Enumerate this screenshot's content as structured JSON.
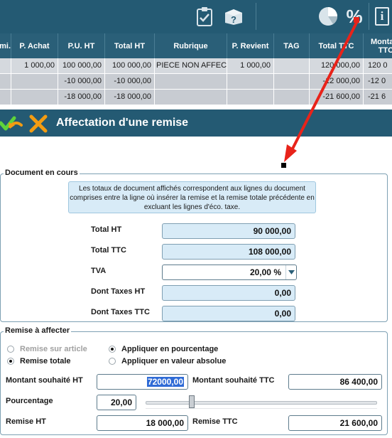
{
  "toolbar": {
    "icons": [
      "clipboard-check-icon",
      "box-question-icon",
      "pie-chart-icon",
      "percent-icon",
      "info-icon"
    ],
    "percent_label": "%",
    "info_label": "i"
  },
  "grid": {
    "columns": [
      "...mi.",
      "P. Achat",
      "P.U. HT",
      "Total HT",
      "Rubrique",
      "P. Revient",
      "TAG",
      "Total TTC",
      "Montant TTC"
    ],
    "rows": [
      [
        "",
        "1 000,00",
        "100 000,00",
        "100 000,00",
        "PIECE NON AFFECTEE",
        "1 000,00",
        "",
        "120 000,00",
        "120 0"
      ],
      [
        "",
        "",
        "-10 000,00",
        "-10 000,00",
        "",
        "",
        "",
        "-12 000,00",
        "-12 0"
      ],
      [
        "",
        "",
        "-18 000,00",
        "-18 000,00",
        "",
        "",
        "",
        "-21 600,00",
        "-21 6"
      ]
    ]
  },
  "dialog": {
    "title": "Affectation d'une remise",
    "document_group": {
      "legend": "Document en cours",
      "info": "Les totaux de document affichés correspondent aux lignes du document comprises entre la ligne où insérer la remise et la remise totale précédente en excluant les lignes d'éco. taxe.",
      "total_ht_label": "Total HT",
      "total_ht": "90 000,00",
      "total_ttc_label": "Total TTC",
      "total_ttc": "108 000,00",
      "tva_label": "TVA",
      "tva": "20,00 %",
      "taxes_ht_label": "Dont Taxes HT",
      "taxes_ht": "0,00",
      "taxes_ttc_label": "Dont Taxes TTC",
      "taxes_ttc": "0,00"
    },
    "remise_group": {
      "legend": "Remise à affecter",
      "radio_article": "Remise sur article",
      "radio_totale": "Remise totale",
      "radio_pourcentage": "Appliquer en pourcentage",
      "radio_absolue": "Appliquer en valeur absolue",
      "montant_ht_label": "Montant souhaité HT",
      "montant_ht": "72000,00",
      "montant_ttc_label": "Montant souhaité TTC",
      "montant_ttc": "86 400,00",
      "pourcentage_label": "Pourcentage",
      "pourcentage": "20,00",
      "slider_level_percent": 20,
      "remise_ht_label": "Remise HT",
      "remise_ht": "18 000,00",
      "remise_ttc_label": "Remise TTC",
      "remise_ttc": "21 600,00"
    }
  },
  "colors": {
    "toolbar": "#245a73",
    "header": "#2a5f78",
    "field_bg": "#d8ebf7",
    "annotation_arrow": "#e8231a"
  }
}
